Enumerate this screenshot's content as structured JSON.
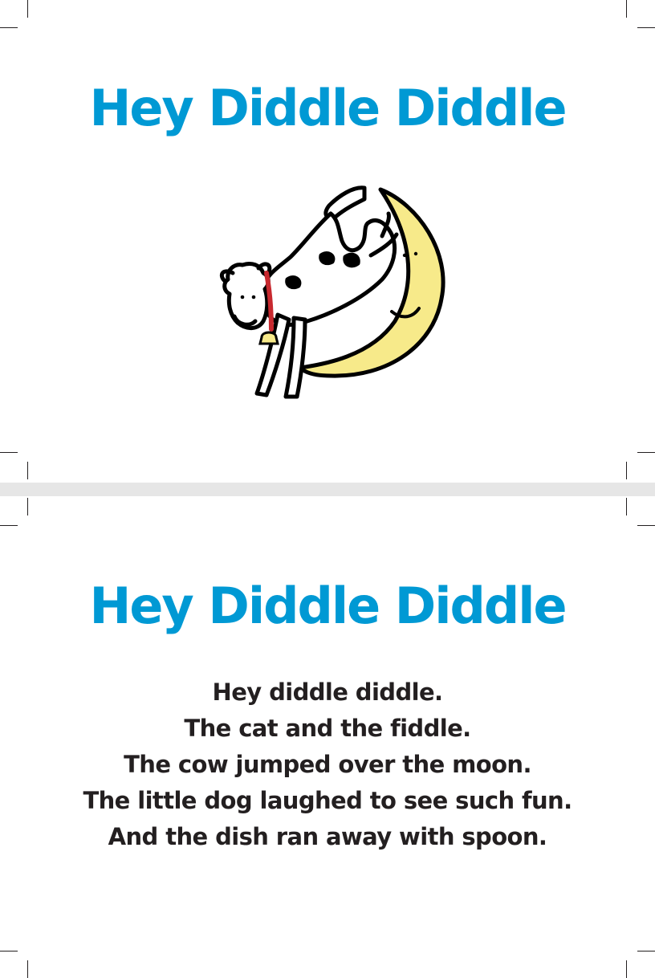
{
  "colors": {
    "title": "#0099d4",
    "text": "#231f20",
    "moon": "#f7ea8a",
    "collar": "#c8292f",
    "divider": "#e6e6e6"
  },
  "cover_card": {
    "title": "Hey Diddle Diddle",
    "illustration": "cow-jumping-over-moon"
  },
  "poem_card": {
    "title": "Hey Diddle Diddle",
    "lines": [
      "Hey diddle diddle.",
      "The cat and the fiddle.",
      "The cow jumped over the moon.",
      "The little dog laughed to see such fun.",
      "And the dish ran away with spoon."
    ]
  }
}
